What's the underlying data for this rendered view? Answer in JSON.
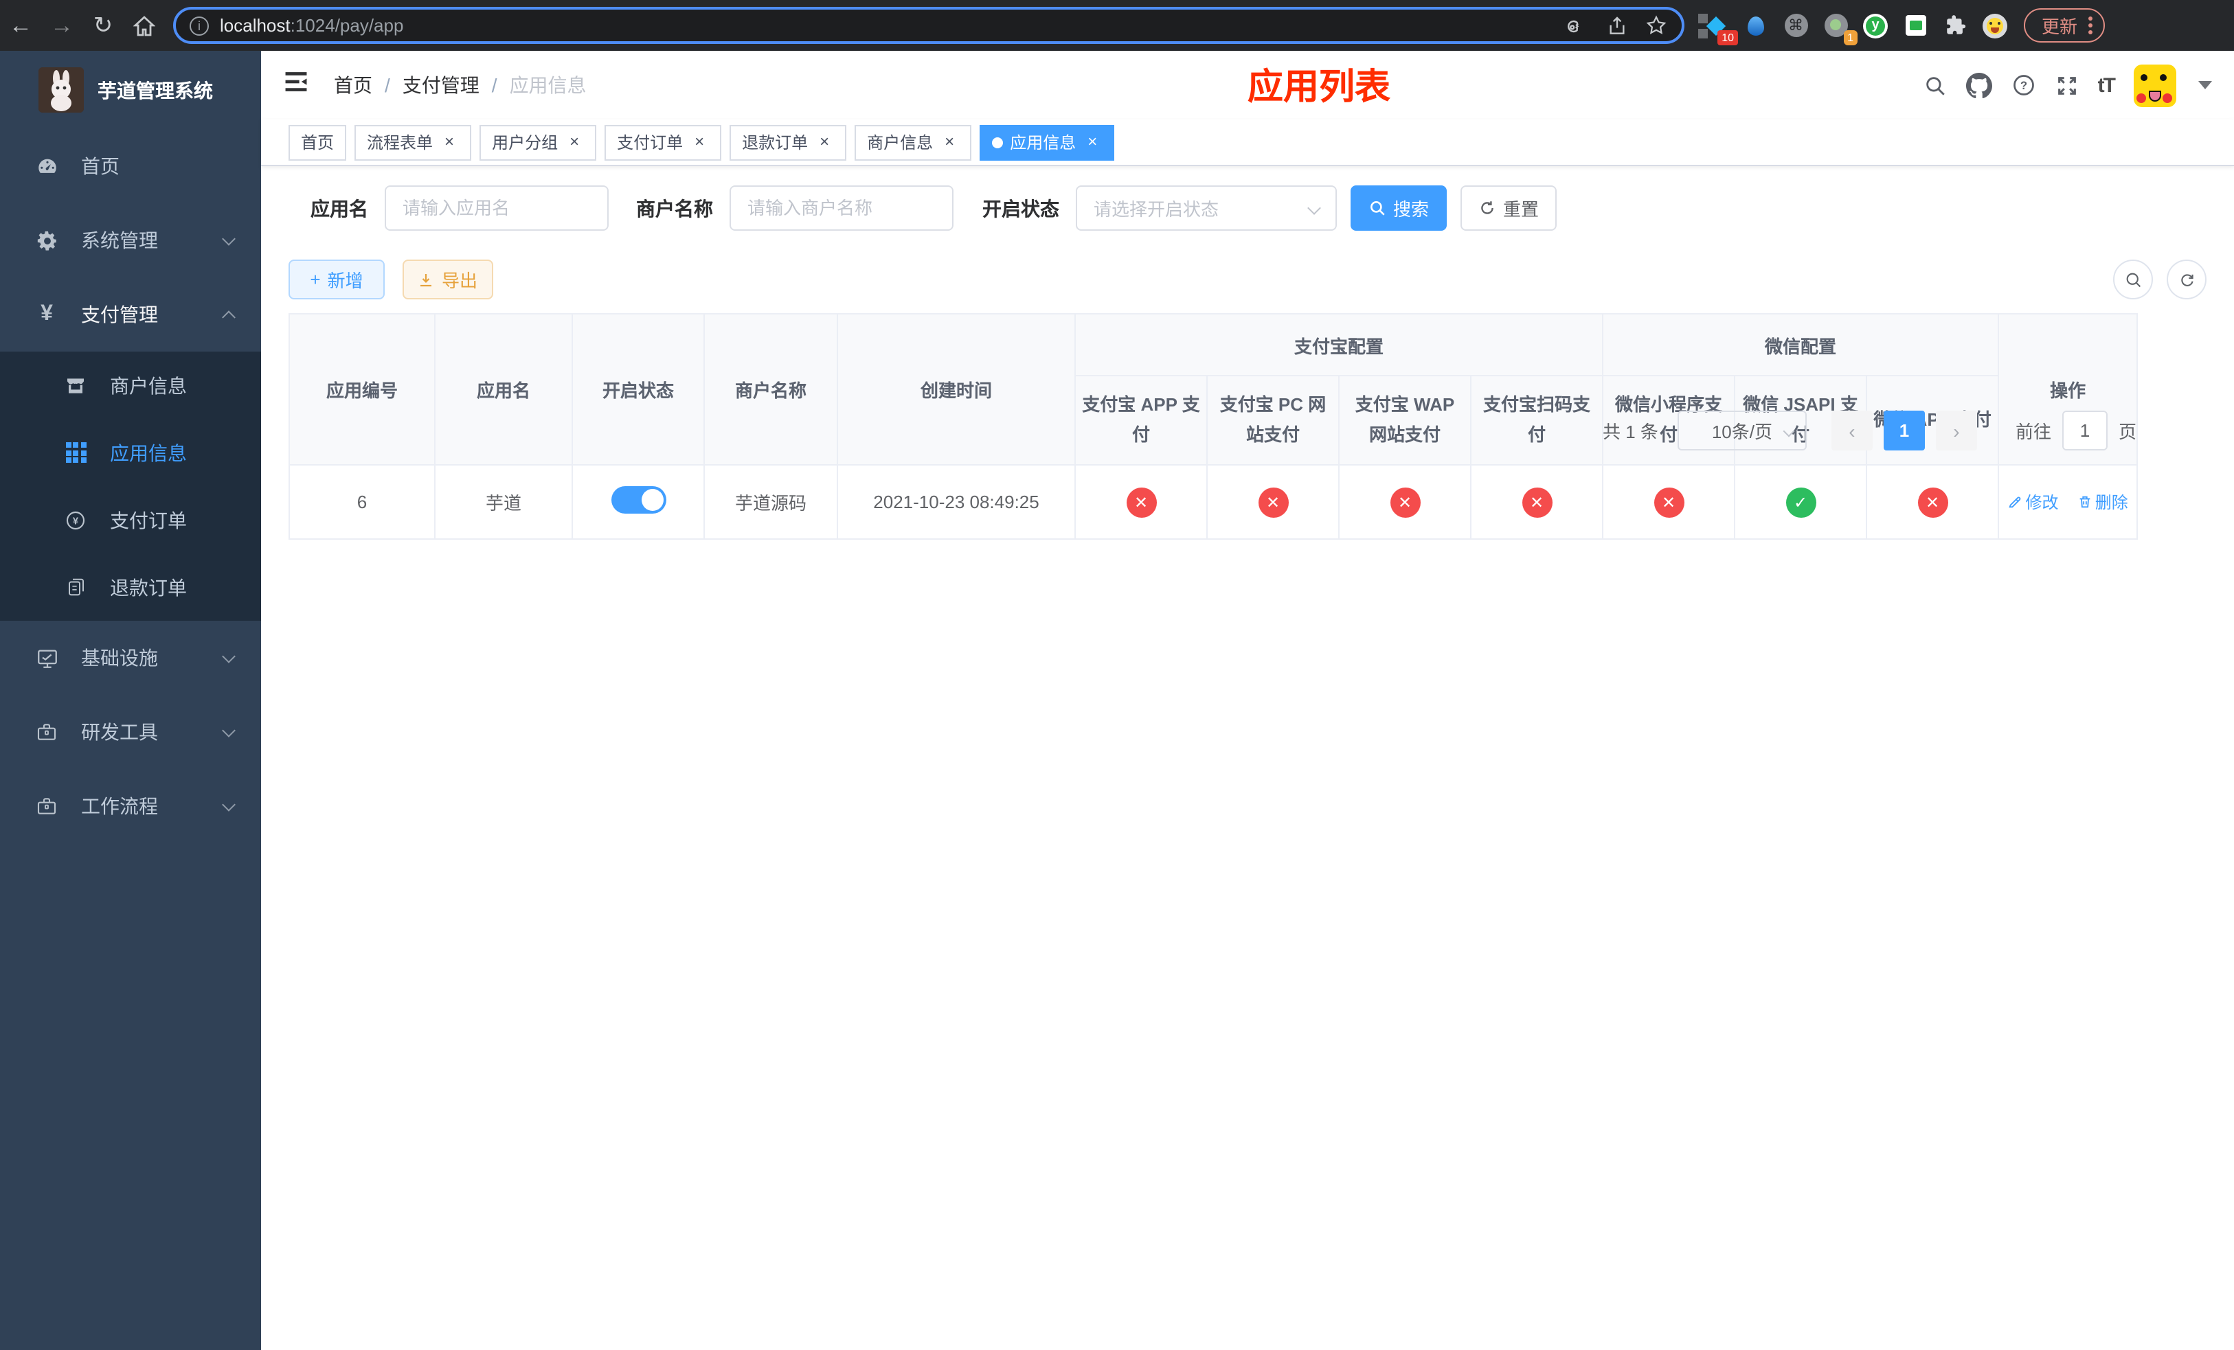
{
  "browser": {
    "host": "localhost",
    "path": ":1024/pay/app",
    "update_label": "更新",
    "ext_badge_pinned": "10",
    "ext_badge_proxy": "1"
  },
  "icons": {
    "back": "←",
    "forward": "→",
    "reload": "↻",
    "close": "×",
    "check": "✓",
    "cross": "✕",
    "plus": "+",
    "prev": "‹",
    "next": "›",
    "font_size": "tT",
    "command": "⌘",
    "yuque": "y",
    "info": "i"
  },
  "sidebar": {
    "logo_title": "芋道管理系统",
    "items": [
      {
        "label": "首页"
      },
      {
        "label": "系统管理"
      },
      {
        "label": "支付管理"
      },
      {
        "label": "商户信息"
      },
      {
        "label": "应用信息"
      },
      {
        "label": "支付订单"
      },
      {
        "label": "退款订单"
      },
      {
        "label": "基础设施"
      },
      {
        "label": "研发工具"
      },
      {
        "label": "工作流程"
      }
    ]
  },
  "header": {
    "breadcrumb": [
      "首页",
      "支付管理",
      "应用信息"
    ],
    "annotation": "应用列表"
  },
  "tabs": [
    {
      "label": "首页",
      "closable": false,
      "active": false
    },
    {
      "label": "流程表单",
      "closable": true,
      "active": false
    },
    {
      "label": "用户分组",
      "closable": true,
      "active": false
    },
    {
      "label": "支付订单",
      "closable": true,
      "active": false
    },
    {
      "label": "退款订单",
      "closable": true,
      "active": false
    },
    {
      "label": "商户信息",
      "closable": true,
      "active": false
    },
    {
      "label": "应用信息",
      "closable": true,
      "active": true
    }
  ],
  "filters": {
    "app_name_label": "应用名",
    "app_name_placeholder": "请输入应用名",
    "merchant_label": "商户名称",
    "merchant_placeholder": "请输入商户名称",
    "status_label": "开启状态",
    "status_placeholder": "请选择开启状态",
    "search_label": "搜索",
    "reset_label": "重置"
  },
  "toolbar": {
    "add_label": "新增",
    "export_label": "导出"
  },
  "table": {
    "group_alipay": "支付宝配置",
    "group_wechat": "微信配置",
    "columns": {
      "id": "应用编号",
      "name": "应用名",
      "status": "开启状态",
      "merchant": "商户名称",
      "created": "创建时间",
      "alipay_app": "支付宝 APP 支付",
      "alipay_pc": "支付宝 PC 网站支付",
      "alipay_wap": "支付宝 WAP 网站支付",
      "alipay_qr": "支付宝扫码支付",
      "wx_mini": "微信小程序支付",
      "wx_jsapi": "微信 JSAPI 支付",
      "wx_app": "微信 APP 支付",
      "ops": "操作"
    },
    "rows": [
      {
        "id": "6",
        "name": "芋道",
        "enabled": true,
        "merchant": "芋道源码",
        "created": "2021-10-23 08:49:25",
        "pay_status": [
          "no",
          "no",
          "no",
          "no",
          "no",
          "yes",
          "no"
        ]
      }
    ],
    "edit_label": "修改",
    "delete_label": "删除"
  },
  "pagination": {
    "total_text": "共 1 条",
    "page_size": "10条/页",
    "current_page": "1",
    "goto_label": "前往",
    "goto_value": "1",
    "page_unit": "页"
  },
  "colors": {
    "accent": "#409eff",
    "danger": "#f44c4c",
    "success": "#2dbd5f",
    "annotation": "#ff2d00",
    "sidebar_bg": "#304156",
    "submenu_bg": "#1f2d3d"
  }
}
